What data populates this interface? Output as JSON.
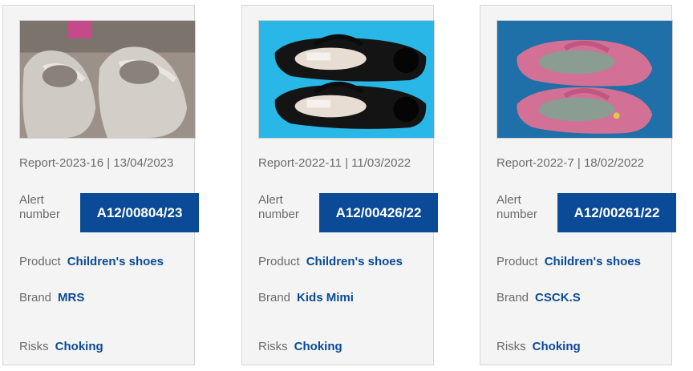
{
  "labels": {
    "alert_number": "Alert number",
    "product": "Product",
    "brand": "Brand",
    "risks": "Risks"
  },
  "colors": {
    "accent": "#0a4a96",
    "label_gray": "#6b6b6b",
    "card_bg": "#f4f4f4"
  },
  "cards": [
    {
      "image_icon": "silver-shoes-photo",
      "report": "Report-2023-16 | 13/04/2023",
      "alert_number": "A12/00804/23",
      "product": "Children's shoes",
      "brand": "MRS",
      "risks": "Choking"
    },
    {
      "image_icon": "black-shoes-photo",
      "report": "Report-2022-11 | 11/03/2022",
      "alert_number": "A12/00426/22",
      "product": "Children's shoes",
      "brand": "Kids Mimi",
      "risks": "Choking"
    },
    {
      "image_icon": "pink-shoes-photo",
      "report": "Report-2022-7 | 18/02/2022",
      "alert_number": "A12/00261/22",
      "product": "Children's shoes",
      "brand": "CSCK.S",
      "risks": "Choking"
    }
  ]
}
